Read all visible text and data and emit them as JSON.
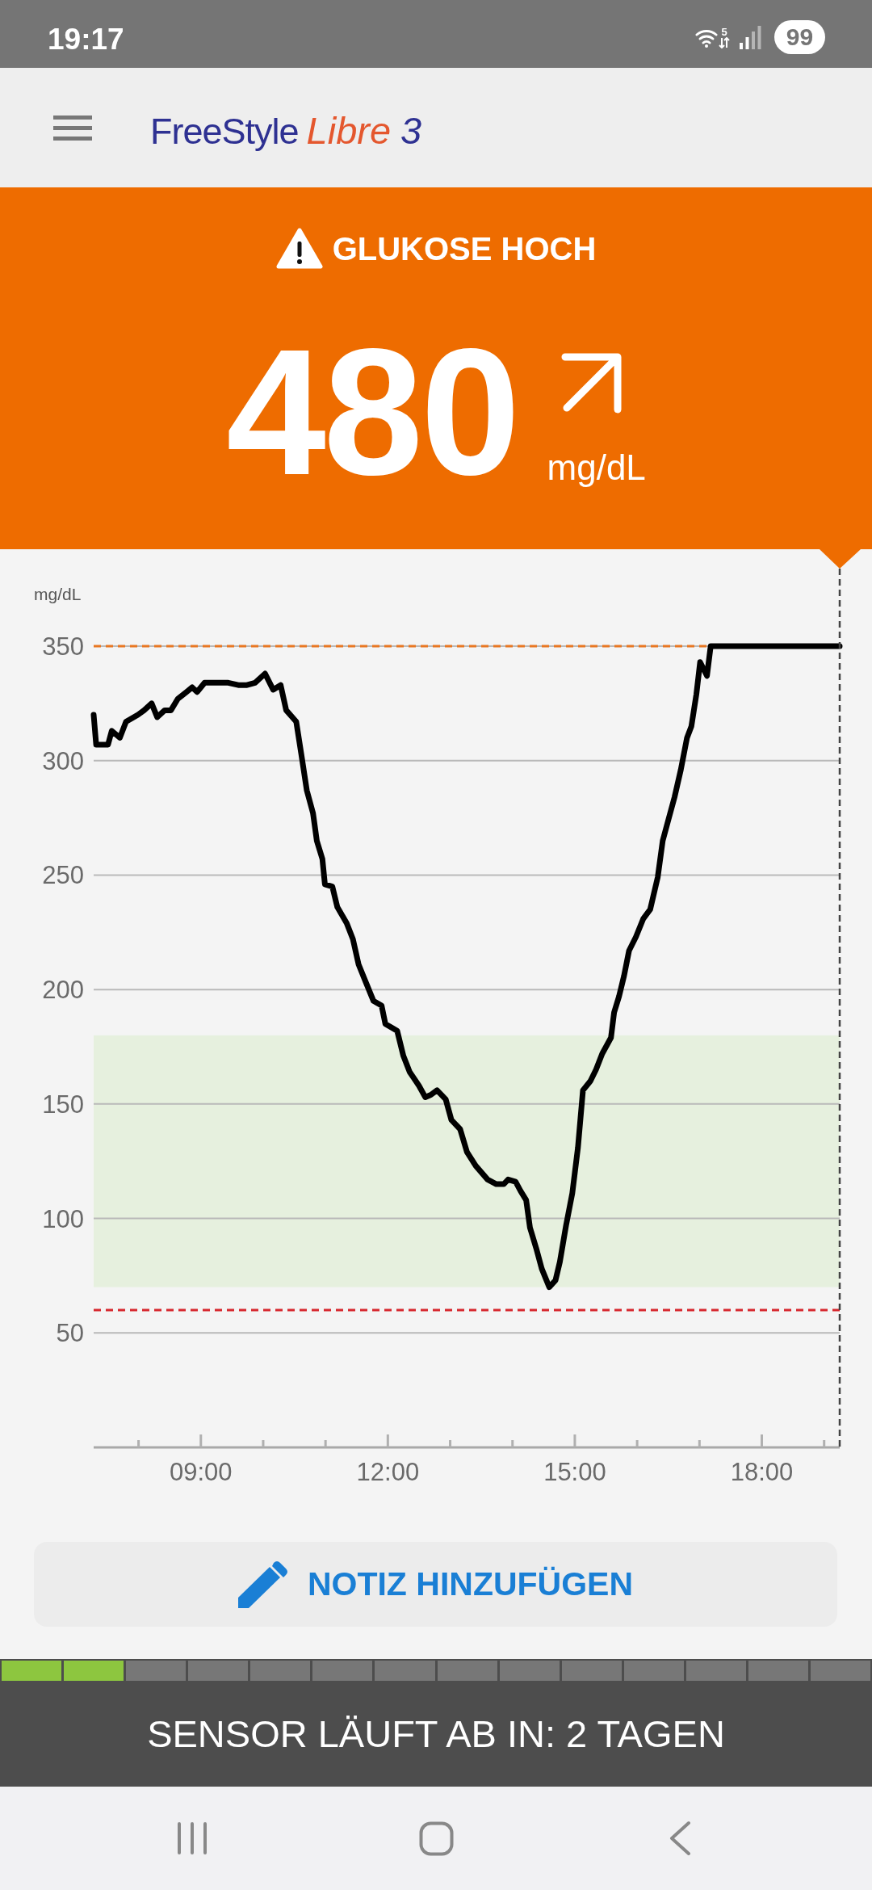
{
  "status_bar": {
    "time": "19:17",
    "wifi_label": "5",
    "battery": "99"
  },
  "header": {
    "logo": {
      "brand": "FreeStyle",
      "product": "Libre",
      "version": "3"
    }
  },
  "alert": {
    "kind": "high",
    "title": "GLUKOSE HOCH",
    "value": "480",
    "unit": "mg/dL",
    "trend_arrow": {
      "kind": "rising"
    }
  },
  "chart": {
    "chart_data": {
      "type": "line",
      "ylabel": "mg/dL",
      "x": [
        7.28,
        7.32,
        7.51,
        7.57,
        7.7,
        7.8,
        7.99,
        8.09,
        8.21,
        8.3,
        8.42,
        8.52,
        8.63,
        8.77,
        8.86,
        8.94,
        9.06,
        9.25,
        9.44,
        9.6,
        9.74,
        9.87,
        10.03,
        10.16,
        10.28,
        10.37,
        10.53,
        10.61,
        10.7,
        10.8,
        10.86,
        10.95,
        10.99,
        11.11,
        11.19,
        11.34,
        11.44,
        11.53,
        11.65,
        11.77,
        11.9,
        11.96,
        12.15,
        12.25,
        12.35,
        12.5,
        12.6,
        12.69,
        12.79,
        12.93,
        13.02,
        13.16,
        13.27,
        13.41,
        13.6,
        13.74,
        13.86,
        13.93,
        14.05,
        14.13,
        14.22,
        14.28,
        14.38,
        14.47,
        14.59,
        14.69,
        14.76,
        14.86,
        14.96,
        15.05,
        15.13,
        15.25,
        15.34,
        15.44,
        15.58,
        15.63,
        15.71,
        15.79,
        15.87,
        15.98,
        16.1,
        16.21,
        16.33,
        16.41,
        16.5,
        16.6,
        16.7,
        16.8,
        16.87,
        16.95,
        17.01,
        17.12,
        17.18,
        19.25
      ],
      "series": [
        {
          "color": "#000000",
          "values": [
            320,
            307,
            307,
            313,
            310,
            317,
            320,
            322,
            325,
            319,
            322,
            322,
            327,
            330,
            332,
            330,
            334,
            334,
            334,
            333,
            333,
            334,
            338,
            331,
            333,
            322,
            317,
            303,
            287,
            277,
            265,
            257,
            246,
            245,
            236,
            229,
            222,
            211,
            203,
            195,
            193,
            185,
            182,
            171,
            164,
            158,
            153,
            154,
            156,
            152,
            143,
            139,
            129,
            123,
            117,
            115,
            115,
            117,
            116,
            112,
            108,
            96,
            87,
            78,
            70,
            73,
            81,
            97,
            111,
            131,
            156,
            160,
            165,
            172,
            179,
            190,
            197,
            206,
            217,
            223,
            231,
            235,
            249,
            265,
            274,
            284,
            296,
            310,
            315,
            329,
            343,
            337,
            350,
            350
          ]
        }
      ],
      "xlim": [
        7.28,
        19.25
      ],
      "ylim": [
        0,
        350
      ],
      "xticks": [
        {
          "value": 9,
          "label": "09:00"
        },
        {
          "value": 12,
          "label": "12:00"
        },
        {
          "value": 15,
          "label": "15:00"
        },
        {
          "value": 18,
          "label": "18:00"
        }
      ],
      "yticks": [
        50,
        100,
        150,
        200,
        250,
        300,
        350
      ],
      "grid": true,
      "bands": [
        {
          "axis": "y",
          "from": 70,
          "to": 180,
          "color": "#e6f0de"
        }
      ],
      "ref_lines": [
        {
          "axis": "y",
          "value": 350,
          "color": "#e87722"
        },
        {
          "axis": "y",
          "value": 60,
          "color": "#d7282f"
        },
        {
          "axis": "x",
          "value": 19.25,
          "color": "#444444"
        }
      ]
    }
  },
  "note_button": {
    "label": "NOTIZ HINZUFÜGEN"
  },
  "sensor": {
    "segments": [
      {
        "filled": true
      },
      {
        "filled": true
      },
      {
        "filled": false
      },
      {
        "filled": false
      },
      {
        "filled": false
      },
      {
        "filled": false
      },
      {
        "filled": false
      },
      {
        "filled": false
      },
      {
        "filled": false
      },
      {
        "filled": false
      },
      {
        "filled": false
      },
      {
        "filled": false
      },
      {
        "filled": false
      },
      {
        "filled": false
      }
    ],
    "message": "SENSOR LÄUFT AB IN: 2 TAGEN"
  },
  "nav_bar": {
    "buttons": [
      {
        "kind": "recent"
      },
      {
        "kind": "home"
      },
      {
        "kind": "back"
      }
    ]
  }
}
